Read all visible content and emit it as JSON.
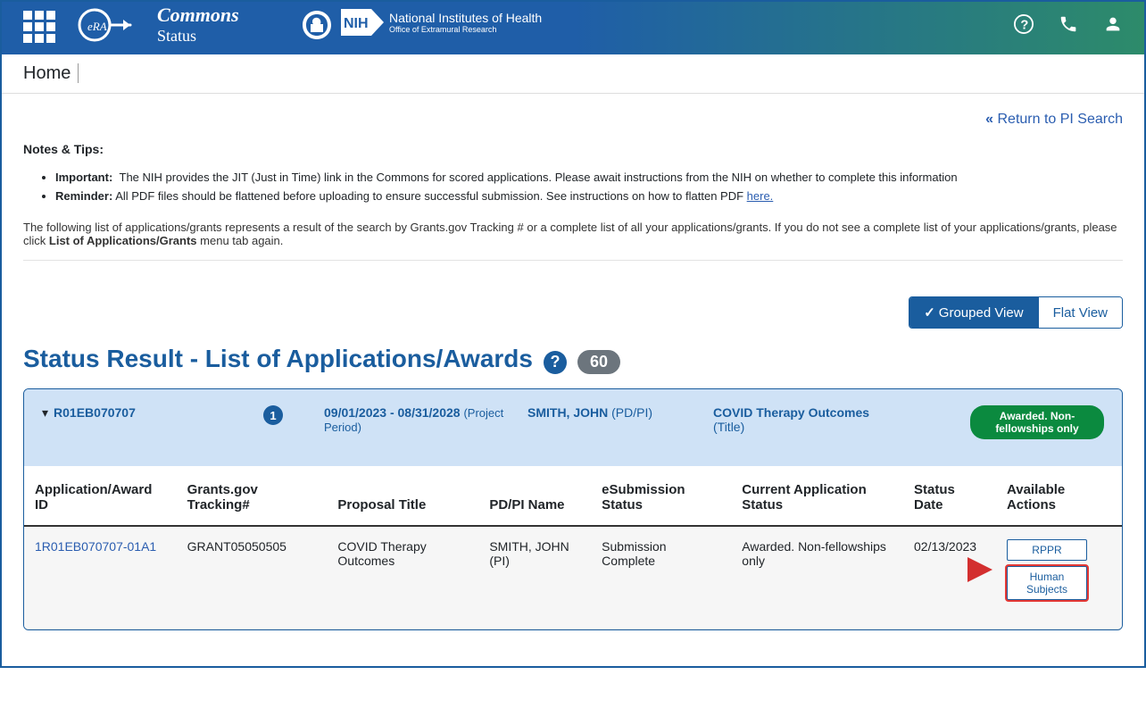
{
  "brand": {
    "title": "Commons",
    "sub": "Status",
    "nih_line1": "National Institutes of Health",
    "nih_line2": "Office of Extramural Research"
  },
  "breadcrumb": {
    "home": "Home"
  },
  "return_link": "Return to PI Search",
  "notes": {
    "title": "Notes & Tips:",
    "important_label": "Important:",
    "important_text": "The NIH provides the JIT (Just in Time) link in the Commons for scored applications. Please await instructions from the NIH on whether to complete this information",
    "reminder_label": "Reminder:",
    "reminder_text": "All PDF files should be flattened before uploading to ensure successful submission. See instructions on how to flatten PDF ",
    "reminder_link": "here."
  },
  "followup_prefix": "The following list of applications/grants represents a result of the search by Grants.gov Tracking # or a complete list of all your applications/grants. If you do not see a complete list of your applications/grants, please click ",
  "followup_bold": "List of Applications/Grants",
  "followup_suffix": " menu tab again.",
  "views": {
    "grouped": "Grouped View",
    "flat": "Flat View"
  },
  "status_result": {
    "title": "Status Result - List of Applications/Awards",
    "count": "60"
  },
  "group": {
    "grant_id": "R01EB070707",
    "badge": "1",
    "period": "09/01/2023 - 08/31/2028",
    "period_label": "(Project Period)",
    "pi_name": "SMITH, JOHN",
    "pi_role": "(PD/PI)",
    "title": "COVID Therapy Outcomes",
    "title_label": "(Title)",
    "status_pill": "Awarded. Non-fellowships only"
  },
  "table": {
    "headers": {
      "appid": "Application/Award ID",
      "tracking": "Grants.gov Tracking#",
      "proposal": "Proposal Title",
      "pdpi": "PD/PI Name",
      "esub": "eSubmission Status",
      "curapp": "Current Application Status",
      "statusdate": "Status Date",
      "actions": "Available Actions"
    },
    "row": {
      "appid": "1R01EB070707-01A1",
      "tracking": "GRANT05050505",
      "proposal": "COVID Therapy Outcomes",
      "pdpi": "SMITH, JOHN (PI)",
      "esub": "Submission Complete",
      "curapp": "Awarded. Non-fellowships only",
      "statusdate": "02/13/2023",
      "action1": "RPPR",
      "action2": "Human Subjects"
    }
  }
}
